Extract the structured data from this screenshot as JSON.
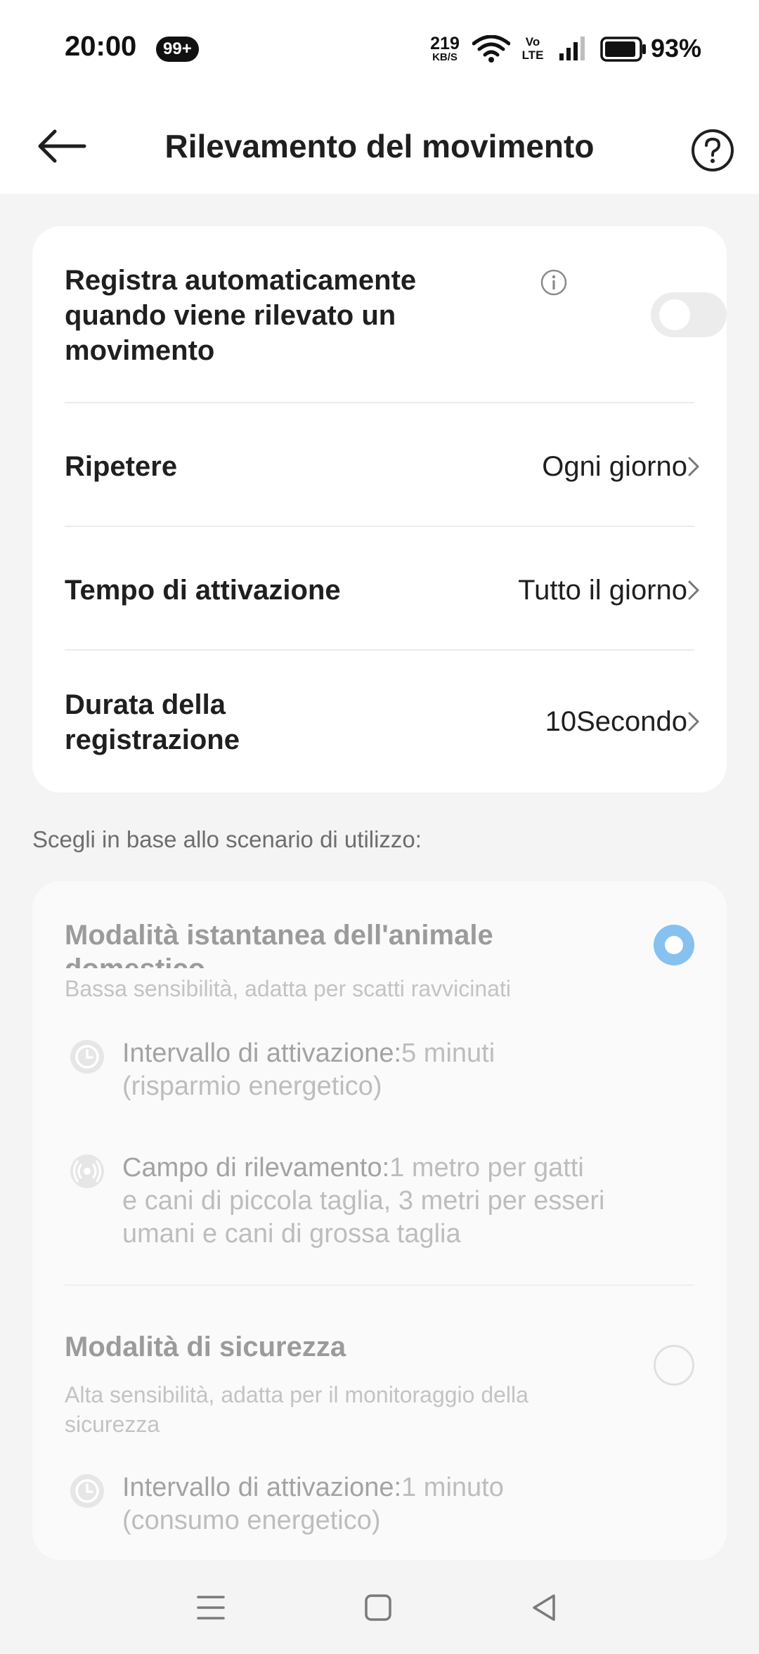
{
  "status_bar": {
    "time": "20:00",
    "badge": "99+",
    "net_speed_value": "219",
    "net_speed_unit": "KB/S",
    "volte_top": "Vo",
    "volte_bottom": "LTE",
    "battery_text": "93%",
    "battery_level": 0.93
  },
  "header": {
    "title": "Rilevamento del movimento"
  },
  "settings": {
    "auto_record": {
      "label_lines": [
        "Registra automaticamente",
        "quando viene rilevato un",
        "movimento"
      ],
      "enabled": false
    },
    "repeat": {
      "label": "Ripetere",
      "value": "Ogni giorno"
    },
    "activation_time": {
      "label": "Tempo di attivazione",
      "value": "Tutto il giorno"
    },
    "recording_duration": {
      "label_lines": [
        "Durata della",
        "registrazione"
      ],
      "value": "10Secondo"
    }
  },
  "section_caption": "Scegli in base allo scenario di utilizzo:",
  "modes": [
    {
      "title_lines": [
        "Modalità istantanea dell'animale",
        "domestico"
      ],
      "subtitle": "Bassa sensibilità, adatta per scatti ravvicinati",
      "selected": true,
      "features": [
        {
          "icon": "clock-icon",
          "key": "Intervallo di attivazione:",
          "value": "5 minuti",
          "extra_lines": [
            "(risparmio energetico)"
          ]
        },
        {
          "icon": "radar-icon",
          "key": "Campo di rilevamento:",
          "value": "1 metro per gatti",
          "extra_lines": [
            "e cani di piccola taglia, 3 metri per esseri",
            "umani e cani di grossa taglia"
          ]
        }
      ]
    },
    {
      "title_lines": [
        "Modalità di sicurezza"
      ],
      "subtitle_lines": [
        "Alta sensibilità, adatta per il monitoraggio della",
        "sicurezza"
      ],
      "selected": false,
      "features": [
        {
          "icon": "clock-icon",
          "key": "Intervallo di attivazione:",
          "value": "1 minuto",
          "extra_lines": [
            "(consumo energetico)"
          ]
        }
      ]
    }
  ],
  "colors": {
    "radio_selected": "#86c1ef",
    "toggle_off": "#ececec",
    "background": "#f4f4f4"
  }
}
